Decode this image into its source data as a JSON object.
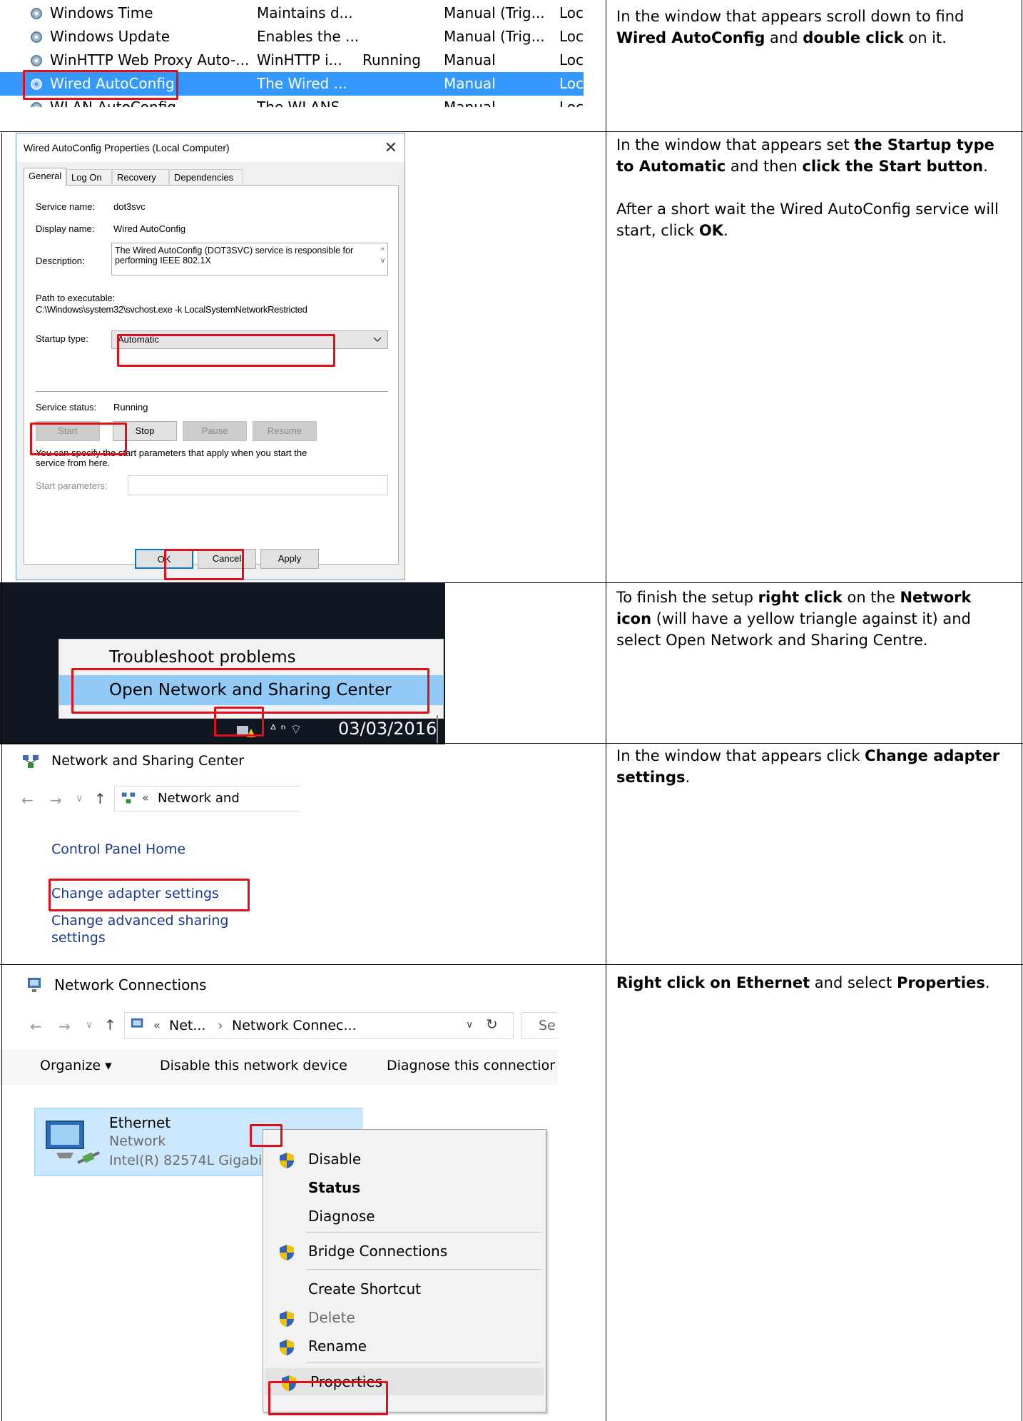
{
  "services": {
    "rows": [
      {
        "name": "Windows Time",
        "description": "Maintains d...",
        "status": "",
        "startup": "Manual (Trig...",
        "logon": "Loc",
        "selected": false
      },
      {
        "name": "Windows Update",
        "description": "Enables the ...",
        "status": "",
        "startup": "Manual (Trig...",
        "logon": "Loc",
        "selected": false
      },
      {
        "name": "WinHTTP Web Proxy Auto-...",
        "description": "WinHTTP i...",
        "status": "Running",
        "startup": "Manual",
        "logon": "Loc",
        "selected": false
      },
      {
        "name": "Wired AutoConfig",
        "description": "The Wired ...",
        "status": "",
        "startup": "Manual",
        "logon": "Loc",
        "selected": true
      },
      {
        "name": "WLAN AutoConfig",
        "description": "The WLANS...",
        "status": "",
        "startup": "Manual",
        "logon": "Loc",
        "selected": false
      }
    ]
  },
  "dialog": {
    "title": "Wired AutoConfig Properties (Local Computer)",
    "close": "✕",
    "tabs": [
      "General",
      "Log On",
      "Recovery",
      "Dependencies"
    ],
    "service_name_label": "Service name:",
    "service_name": "dot3svc",
    "display_name_label": "Display name:",
    "display_name": "Wired AutoConfig",
    "description_label": "Description:",
    "description": "The Wired AutoConfig (DOT3SVC) service is responsible for performing IEEE 802.1X",
    "path_label": "Path to executable:",
    "path": "C:\\Windows\\system32\\svchost.exe -k LocalSystemNetworkRestricted",
    "startup_type_label": "Startup type:",
    "startup_type": "Automatic",
    "service_status_label": "Service status:",
    "service_status": "Running",
    "start": "Start",
    "stop": "Stop",
    "pause": "Pause",
    "resume": "Resume",
    "params_hint": "You can specify the start parameters that apply when you start the service from here.",
    "params_label": "Start parameters:",
    "ok": "OK",
    "cancel": "Cancel",
    "apply": "Apply"
  },
  "tray_menu": {
    "items": [
      "Troubleshoot problems",
      "Open Network and Sharing Center"
    ],
    "date": "03/03/2016"
  },
  "nsc": {
    "title": "Network and Sharing Center",
    "address": "Network and",
    "address_prefix": "«",
    "links": [
      "Control Panel Home",
      "Change adapter settings",
      "Change advanced sharing",
      "settings"
    ]
  },
  "ncw": {
    "title": "Network Connections",
    "address_prefix": "«",
    "crumbs": [
      "Net...",
      "›",
      "Network Connec..."
    ],
    "search": "Se",
    "toolbar": [
      "Organize ▾",
      "Disable this network device",
      "Diagnose this connectior"
    ],
    "adapter_name": "Ethernet",
    "adapter_network": "Network",
    "adapter_device": "Intel(R) 82574L Gigabit",
    "menu": [
      "Disable",
      "Status",
      "Diagnose",
      "Bridge Connections",
      "Create Shortcut",
      "Delete",
      "Rename",
      "Properties"
    ]
  },
  "steps": {
    "s1_a": "In the window that appears scroll down to find ",
    "s1_b": "Wired AutoConfig",
    "s1_c": " and ",
    "s1_d": "double click",
    "s1_e": " on it.",
    "s2_a": "In the window that appears set ",
    "s2_b": "the Startup type to Automatic",
    "s2_c": " and then ",
    "s2_d": "click the Start button",
    "s2_e": ".",
    "s2_f": "After a short wait the Wired AutoConfig service will start, click ",
    "s2_g": "OK",
    "s2_h": ".",
    "s3_a": "To finish the setup ",
    "s3_b": "right click",
    "s3_c": " on the ",
    "s3_d": "Network icon",
    "s3_e": " (will have a yellow triangle against it) and select Open Network and Sharing Centre.",
    "s4_a": "In the window that appears click ",
    "s4_b": "Change adapter settings",
    "s4_c": ".",
    "s5_a": "Right click on Ethernet",
    "s5_b": " and select ",
    "s5_c": "Properties",
    "s5_d": "."
  },
  "colors": {
    "highlight": "#e0101a",
    "selection": "#3399ff",
    "link": "#1a3a8f"
  }
}
